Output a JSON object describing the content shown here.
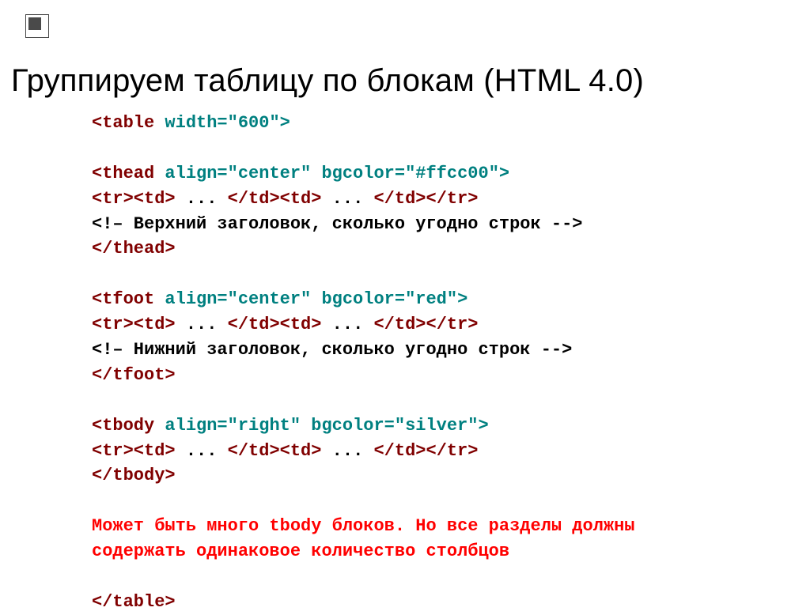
{
  "title": "Группируем таблицу по блокам (HTML 4.0)",
  "code": {
    "l01a": "<table ",
    "l01b": "width=\"600\">",
    "l02": "",
    "l03a": "<thead ",
    "l03b": "align=\"center\" bgcolor=\"#ffcc00\">",
    "l04a": "<tr><td>",
    "l04b": " ... ",
    "l04c": "</td><td>",
    "l04d": " ... ",
    "l04e": "</td></tr>",
    "l05": "<!– Верхний заголовок, сколько угодно строк -->",
    "l06": "</thead>",
    "l07": "",
    "l08a": "<tfoot ",
    "l08b": "align=\"center\" bgcolor=\"red\">",
    "l09a": "<tr><td>",
    "l09b": " ... ",
    "l09c": "</td><td>",
    "l09d": " ... ",
    "l09e": "</td></tr>",
    "l10": "<!– Нижний заголовок, сколько угодно строк -->",
    "l11": "</tfoot>",
    "l12": "",
    "l13a": "<tbody ",
    "l13b": "align=\"right\" bgcolor=\"silver\">",
    "l14a": "<tr><td>",
    "l14b": " ... ",
    "l14c": "</td><td>",
    "l14d": " ... ",
    "l14e": "</td></tr>",
    "l15": "</tbody>",
    "l16": "",
    "note1": "Может быть много tbody блоков. Но все разделы должны",
    "note2": "содержать одинаковое количество столбцов",
    "l19": "",
    "l20": "</table>"
  }
}
